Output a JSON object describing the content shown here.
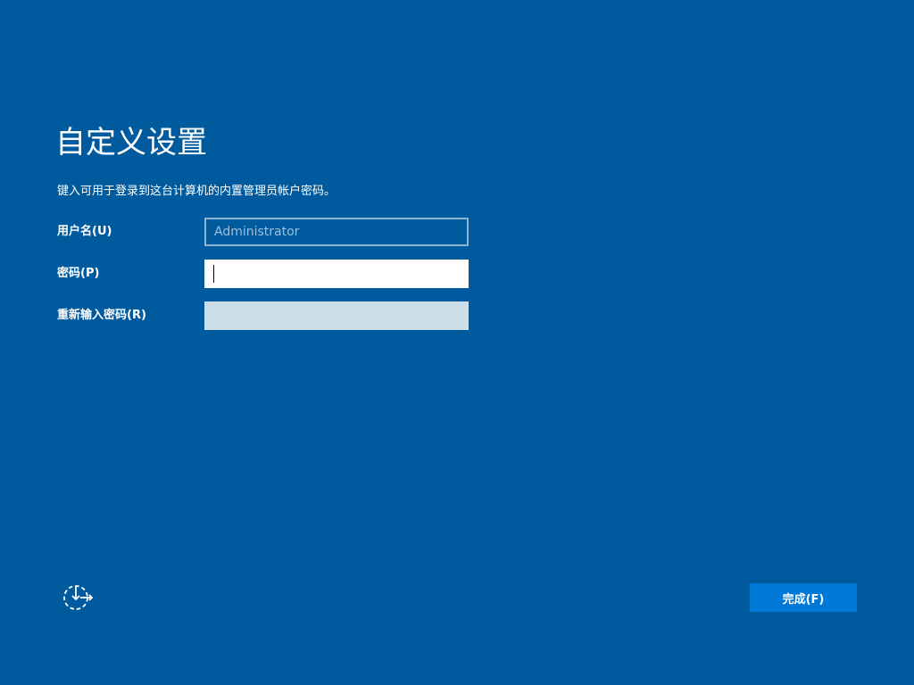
{
  "header": {
    "title": "自定义设置"
  },
  "instruction": "键入可用于登录到这台计算机的内置管理员帐户密码。",
  "form": {
    "username": {
      "label": "用户名(U)",
      "value": "Administrator"
    },
    "password": {
      "label": "密码(P)",
      "value": ""
    },
    "confirm": {
      "label": "重新输入密码(R)",
      "value": ""
    }
  },
  "footer": {
    "accessibility_icon": "ease-of-access-icon",
    "finish_label": "完成(F)"
  },
  "colors": {
    "background": "#005a9e",
    "button": "#0078d7",
    "disabled_field": "#cddeeb"
  }
}
